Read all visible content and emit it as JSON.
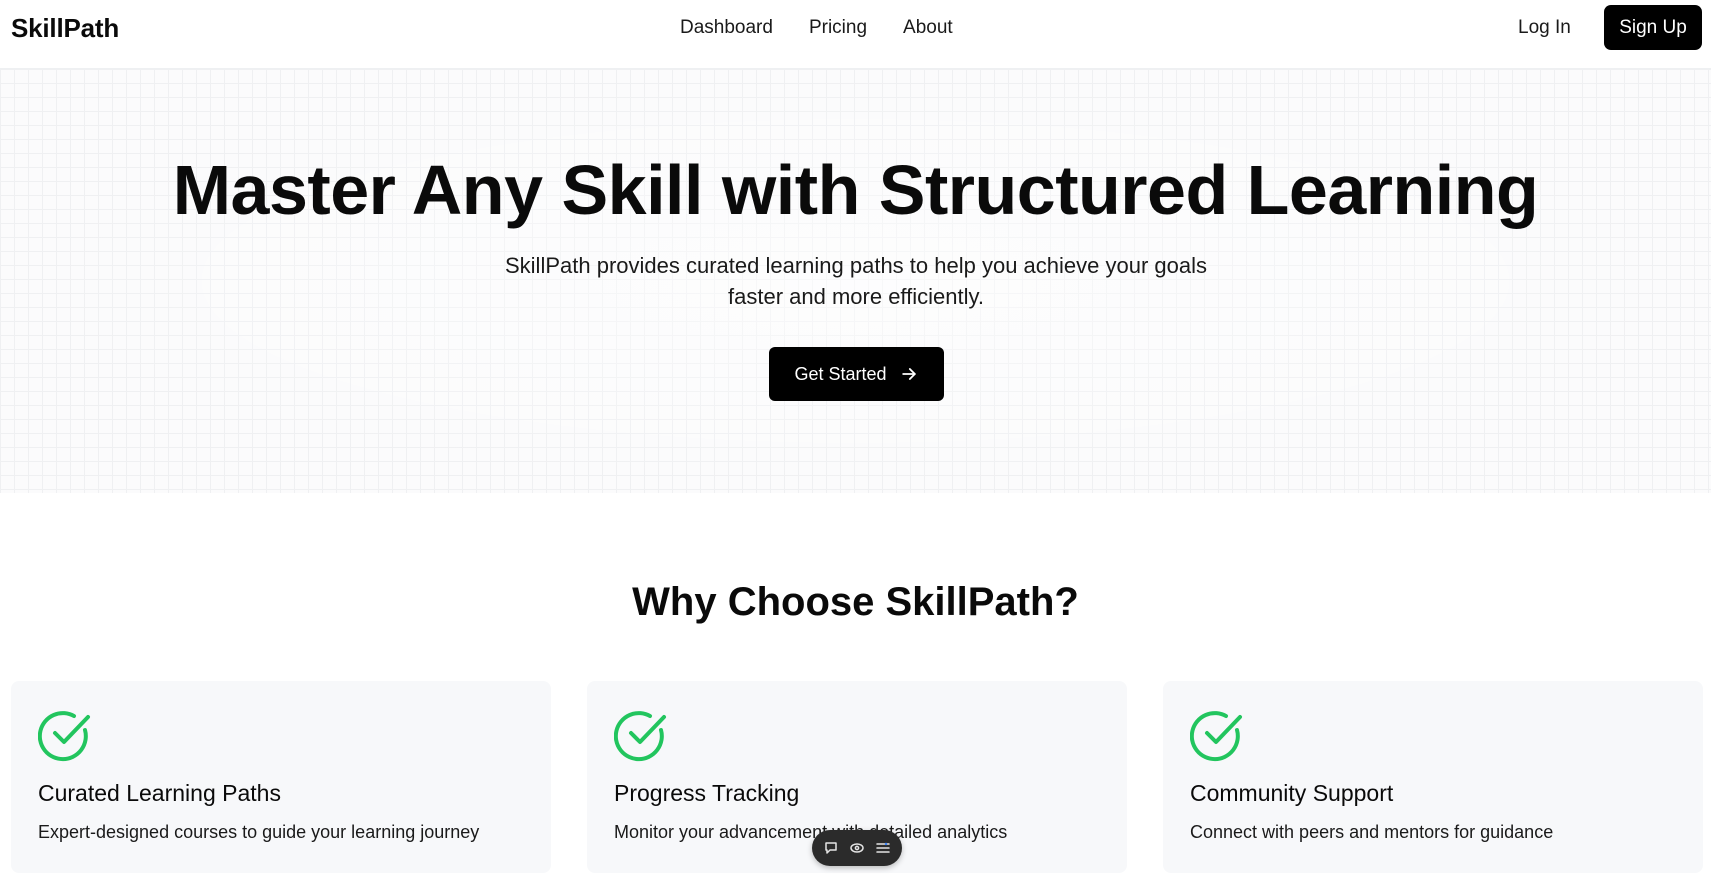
{
  "header": {
    "brand": "SkillPath",
    "nav": [
      "Dashboard",
      "Pricing",
      "About"
    ],
    "login": "Log In",
    "signup": "Sign Up"
  },
  "hero": {
    "title": "Master Any Skill with Structured Learning",
    "subtitle": "SkillPath provides curated learning paths to help you achieve your goals faster and more efficiently.",
    "cta": "Get Started"
  },
  "features": {
    "heading": "Why Choose SkillPath?",
    "cards": [
      {
        "title": "Curated Learning Paths",
        "desc": "Expert-designed courses to guide your learning journey",
        "icon": "check-circle-icon"
      },
      {
        "title": "Progress Tracking",
        "desc": "Monitor your advancement with detailed analytics",
        "icon": "check-circle-icon"
      },
      {
        "title": "Community Support",
        "desc": "Connect with peers and mentors for guidance",
        "icon": "check-circle-icon"
      }
    ]
  },
  "colors": {
    "accent": "#22c55e",
    "primary": "#000000"
  }
}
